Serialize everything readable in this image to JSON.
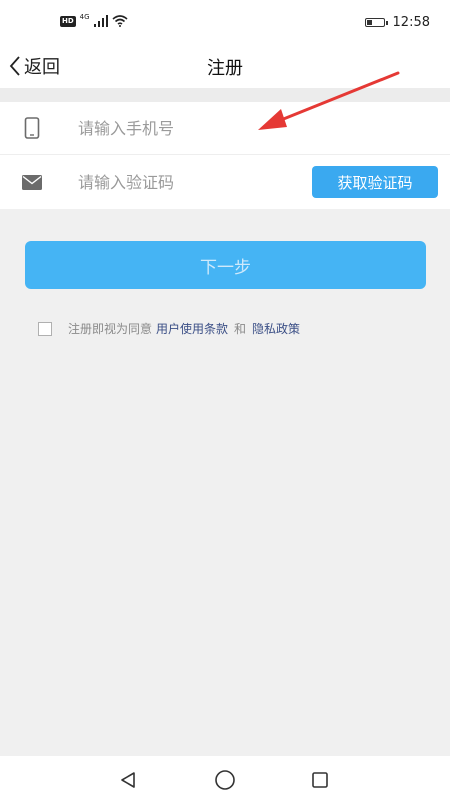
{
  "status_bar": {
    "hd_label": "HD",
    "network_label": "4G",
    "time": "12:58",
    "battery_level": 0.3
  },
  "nav": {
    "back_label": "返回",
    "title": "注册"
  },
  "form": {
    "phone_placeholder": "请输入手机号",
    "code_placeholder": "请输入验证码",
    "get_code_label": "获取验证码"
  },
  "next_button_label": "下一步",
  "agreement": {
    "prefix": "注册即视为同意",
    "terms_link": "用户使用条款",
    "and_text": "和",
    "privacy_link": "隐私政策",
    "checked": false
  },
  "icons": {
    "phone": "phone-icon",
    "mail": "mail-icon",
    "back": "chevron-left-icon",
    "signal": "signal-icon",
    "wifi": "wifi-icon",
    "battery": "battery-icon",
    "sys_back": "triangle-back-icon",
    "sys_home": "circle-home-icon",
    "sys_recent": "square-recent-icon"
  },
  "colors": {
    "accent": "#3aa9f0",
    "next_button": "#45b4f4",
    "link": "#3b4f86",
    "annotation_arrow": "#e53935",
    "background": "#f0f0f0"
  }
}
